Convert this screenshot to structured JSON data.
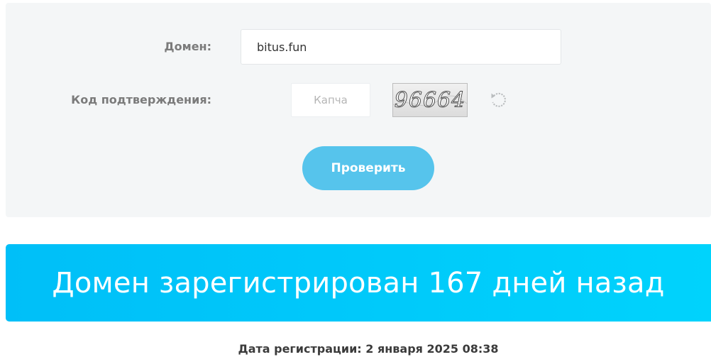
{
  "form": {
    "domain_label": "Домен:",
    "domain_value": "bitus.fun",
    "captcha_label": "Код подтверждения:",
    "captcha_placeholder": "Капча",
    "captcha_image_text": "96664",
    "refresh_icon": "refresh-icon",
    "submit_label": "Проверить"
  },
  "result": {
    "headline": "Домен зарегистрирован 167 дней назад",
    "registration_date": "Дата регистрации: 2 января 2025 08:38"
  },
  "colors": {
    "panel_background": "#f4f6f7",
    "button": "#56c4ec",
    "banner_start": "#00bff8",
    "banner_end": "#00d3fc"
  }
}
